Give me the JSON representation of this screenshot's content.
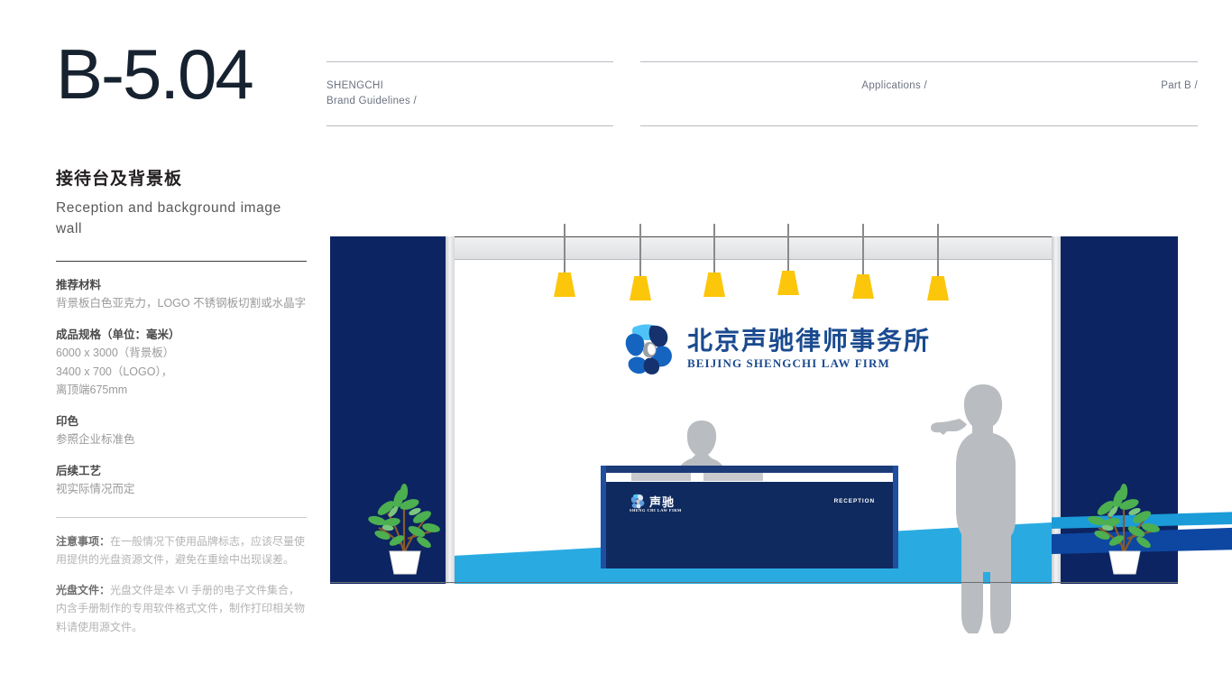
{
  "page": {
    "number": "B-5.04"
  },
  "header": {
    "brand_line1": "SHENGCHI",
    "brand_line2": "Brand Guidelines /",
    "section": "Applications /",
    "part": "Part B /"
  },
  "title": {
    "cn": "接待台及背景板",
    "en": "Reception and background image wall"
  },
  "specs": [
    {
      "heading": "推荐材料",
      "body": "背景板白色亚克力，LOGO 不锈钢板切割或水晶字"
    },
    {
      "heading": "成品规格（单位：毫米）",
      "body": "6000 x 3000（背景板）\n3400 x 700（LOGO），\n离顶端675mm"
    },
    {
      "heading": "印色",
      "body": "参照企业标准色"
    },
    {
      "heading": "后续工艺",
      "body": "视实际情况而定"
    }
  ],
  "notes": [
    {
      "label": "注意事项：",
      "text": "在一般情况下使用品牌标志，应该尽量使用提供的光盘资源文件，避免在重绘中出现误差。"
    },
    {
      "label": "光盘文件：",
      "text": "光盘文件是本 VI 手册的电子文件集合，内含手册制作的专用软件格式文件，制作打印相关物料请使用源文件。"
    }
  ],
  "scene": {
    "wall_logo": {
      "cn": "北京声驰律师事务所",
      "en": "BEIJING SHENGCHI LAW FIRM"
    },
    "desk": {
      "logo_cn": "声驰",
      "logo_en": "SHENG CHI LAW FIRM",
      "label": "RECEPTION"
    },
    "lamp_count": 6,
    "colors": {
      "navy": "#0c2461",
      "desk_navy": "#0f2a5e",
      "logo_blue": "#1a4a8f",
      "light_blue": "#29ABE2",
      "lamp_yellow": "#FCC60B",
      "silhouette_gray": "#b9bcc0"
    }
  }
}
